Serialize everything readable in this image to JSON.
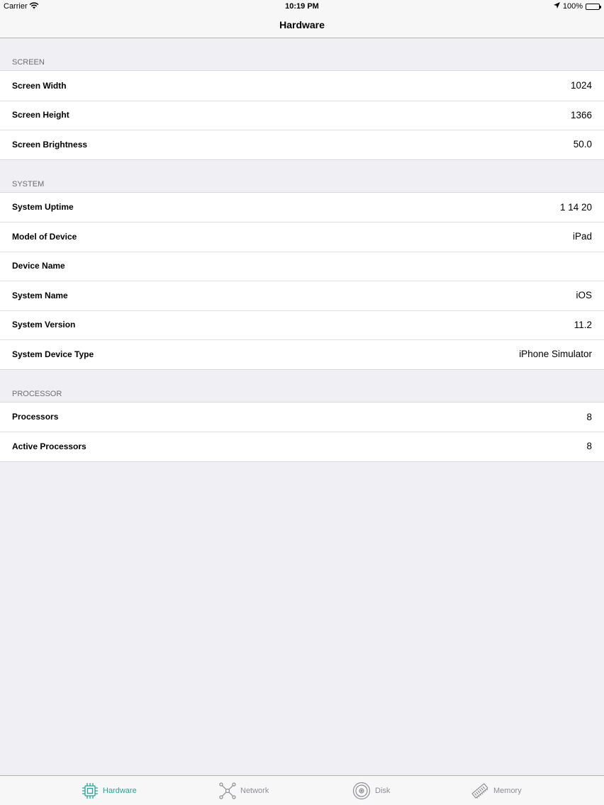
{
  "status": {
    "carrier": "Carrier",
    "time": "10:19 PM",
    "battery": "100%"
  },
  "nav": {
    "title": "Hardware"
  },
  "sections": [
    {
      "header": "SCREEN",
      "rows": [
        {
          "label": "Screen Width",
          "value": "1024"
        },
        {
          "label": "Screen Height",
          "value": "1366"
        },
        {
          "label": "Screen Brightness",
          "value": "50.0"
        }
      ]
    },
    {
      "header": "SYSTEM",
      "rows": [
        {
          "label": "System Uptime",
          "value": "1 14 20"
        },
        {
          "label": "Model of Device",
          "value": "iPad"
        },
        {
          "label": "Device Name",
          "value": ""
        },
        {
          "label": "System Name",
          "value": "iOS"
        },
        {
          "label": "System Version",
          "value": "11.2"
        },
        {
          "label": "System Device Type",
          "value": "iPhone Simulator"
        }
      ]
    },
    {
      "header": "PROCESSOR",
      "rows": [
        {
          "label": "Processors",
          "value": "8"
        },
        {
          "label": "Active Processors",
          "value": "8"
        }
      ]
    }
  ],
  "tabs": [
    {
      "label": "Hardware",
      "icon": "chip-icon",
      "active": true
    },
    {
      "label": "Network",
      "icon": "network-icon",
      "active": false
    },
    {
      "label": "Disk",
      "icon": "disk-icon",
      "active": false
    },
    {
      "label": "Memory",
      "icon": "memory-icon",
      "active": false
    }
  ],
  "colors": {
    "accent": "#2aa198",
    "inactive": "#8e8e93",
    "background": "#efeff4"
  }
}
